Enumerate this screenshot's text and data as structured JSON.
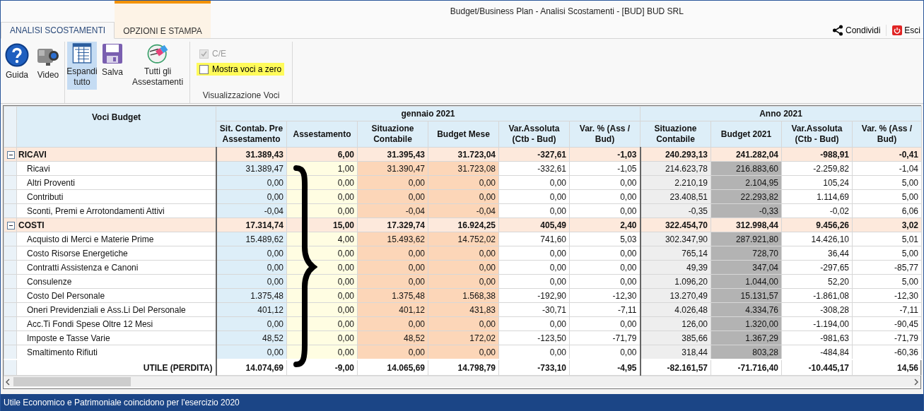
{
  "window": {
    "title": "Budget/Business Plan - Analisi Scostamenti - [BUD] BUD SRL"
  },
  "tabs": [
    {
      "label": "ANALISI SCOSTAMENTI",
      "selected": true
    },
    {
      "label": "OPZIONI E STAMPA",
      "selected": false
    }
  ],
  "header_actions": [
    {
      "kind": "share",
      "label": "Condividi"
    },
    {
      "kind": "exit",
      "label": "Esci"
    }
  ],
  "ribbon": {
    "groups": [
      {
        "buttons": [
          {
            "kind": "help",
            "label": "Guida",
            "selected": false
          },
          {
            "kind": "video",
            "label": "Video",
            "selected": false
          }
        ]
      },
      {
        "buttons": [
          {
            "kind": "expand",
            "label": "Espandi tutto",
            "selected": true
          },
          {
            "kind": "save",
            "label": "Salva",
            "selected": false
          },
          {
            "kind": "adjust",
            "label": "Tutti gli Assestamenti",
            "selected": false
          }
        ]
      },
      {
        "label": "Visualizzazione Voci",
        "checkboxes": [
          {
            "label": "C/E",
            "checked": true,
            "disabled": true,
            "highlighted": false
          },
          {
            "label": "Mostra voci a zero",
            "checked": false,
            "disabled": false,
            "highlighted": true
          }
        ]
      }
    ]
  },
  "table": {
    "first_column": "Voci Budget",
    "column_groups": [
      {
        "label": "gennaio 2021",
        "columns": [
          "Sit. Contab. Pre Assestamento",
          "Assestamento",
          "Situazione Contabile",
          "Budget Mese",
          "Var.Assoluta (Ctb - Bud)",
          "Var. % (Ass / Bud)"
        ]
      },
      {
        "label": "Anno 2021",
        "columns": [
          "Situazione Contabile",
          "Budget 2021",
          "Var.Assoluta (Ctb - Bud)",
          "Var. % (Ass / Bud)"
        ]
      }
    ],
    "rows": [
      {
        "kind": "group",
        "expanded": true,
        "label": "RICAVI",
        "cells": [
          "31.389,43",
          "6,00",
          "31.395,43",
          "31.723,04",
          "-327,61",
          "-1,03",
          "240.293,13",
          "241.282,04",
          "-988,91",
          "-0,41"
        ]
      },
      {
        "kind": "item",
        "label": "Ricavi",
        "cells": [
          "31.389,47",
          "1,00",
          "31.390,47",
          "31.723,08",
          "-332,61",
          "-1,05",
          "214.623,78",
          "216.883,60",
          "-2.259,82",
          "-1,04"
        ]
      },
      {
        "kind": "item",
        "label": "Altri Proventi",
        "cells": [
          "0,00",
          "0,00",
          "0,00",
          "0,00",
          "0,00",
          "0,00",
          "2.210,19",
          "2.104,95",
          "105,24",
          "5,00"
        ]
      },
      {
        "kind": "item",
        "label": "Contributi",
        "cells": [
          "0,00",
          "0,00",
          "0,00",
          "0,00",
          "0,00",
          "0,00",
          "23.408,51",
          "22.293,82",
          "1.114,69",
          "5,00"
        ]
      },
      {
        "kind": "item",
        "label": "Sconti, Premi e Arrotondamenti  Attivi",
        "cells": [
          "-0,04",
          "0,00",
          "-0,04",
          "-0,04",
          "0,00",
          "0,00",
          "-0,35",
          "-0,33",
          "-0,02",
          "6,06"
        ]
      },
      {
        "kind": "group",
        "expanded": true,
        "label": "COSTI",
        "cells": [
          "17.314,74",
          "15,00",
          "17.329,74",
          "16.924,25",
          "405,49",
          "2,40",
          "322.454,70",
          "312.998,44",
          "9.456,26",
          "3,02"
        ]
      },
      {
        "kind": "item",
        "label": "Acquisto di Merci e Materie Prime",
        "cells": [
          "15.489,62",
          "4,00",
          "15.493,62",
          "14.752,02",
          "741,60",
          "5,03",
          "302.347,90",
          "287.921,80",
          "14.426,10",
          "5,01"
        ]
      },
      {
        "kind": "item",
        "label": "Costo Risorse Energetiche",
        "cells": [
          "0,00",
          "0,00",
          "0,00",
          "0,00",
          "0,00",
          "0,00",
          "765,14",
          "728,70",
          "36,44",
          "5,00"
        ]
      },
      {
        "kind": "item",
        "label": "Contratti Assistenza e Canoni",
        "cells": [
          "0,00",
          "0,00",
          "0,00",
          "0,00",
          "0,00",
          "0,00",
          "49,39",
          "347,04",
          "-297,65",
          "-85,77"
        ]
      },
      {
        "kind": "item",
        "label": "Consulenze",
        "cells": [
          "0,00",
          "0,00",
          "0,00",
          "0,00",
          "0,00",
          "0,00",
          "1.096,20",
          "1.044,00",
          "52,20",
          "5,00"
        ]
      },
      {
        "kind": "item",
        "label": "Costo Del Personale",
        "cells": [
          "1.375,48",
          "0,00",
          "1.375,48",
          "1.568,38",
          "-192,90",
          "-12,30",
          "13.270,49",
          "15.131,57",
          "-1.861,08",
          "-12,30"
        ]
      },
      {
        "kind": "item",
        "label": "Oneri Previdenziali e Ass.Li Del Personale",
        "cells": [
          "401,12",
          "0,00",
          "401,12",
          "431,83",
          "-30,71",
          "-7,11",
          "4.026,48",
          "4.334,76",
          "-308,28",
          "-7,11"
        ]
      },
      {
        "kind": "item",
        "label": "Acc.Ti Fondi Spese Oltre 12 Mesi",
        "cells": [
          "0,00",
          "0,00",
          "0,00",
          "0,00",
          "0,00",
          "0,00",
          "126,00",
          "1.320,00",
          "-1.194,00",
          "-90,45"
        ]
      },
      {
        "kind": "item",
        "label": "Imposte e Tasse Varie",
        "cells": [
          "48,52",
          "0,00",
          "48,52",
          "172,02",
          "-123,50",
          "-71,79",
          "385,66",
          "1.367,29",
          "-981,63",
          "-71,79"
        ]
      },
      {
        "kind": "item",
        "label": "Smaltimento Rifiuti",
        "cells": [
          "0,00",
          "0,00",
          "0,00",
          "0,00",
          "0,00",
          "0,00",
          "318,44",
          "803,28",
          "-484,84",
          "-60,36"
        ]
      },
      {
        "kind": "total",
        "label": "UTILE (PERDITA)",
        "cells": [
          "14.074,69",
          "-9,00",
          "14.065,69",
          "14.798,79",
          "-733,10",
          "-4,95",
          "-82.161,57",
          "-71.716,40",
          "-10.445,17",
          "14,56"
        ]
      }
    ]
  },
  "status_bar": "Utile Economico e Patrimoniale coincidono per l'esercizio 2020"
}
